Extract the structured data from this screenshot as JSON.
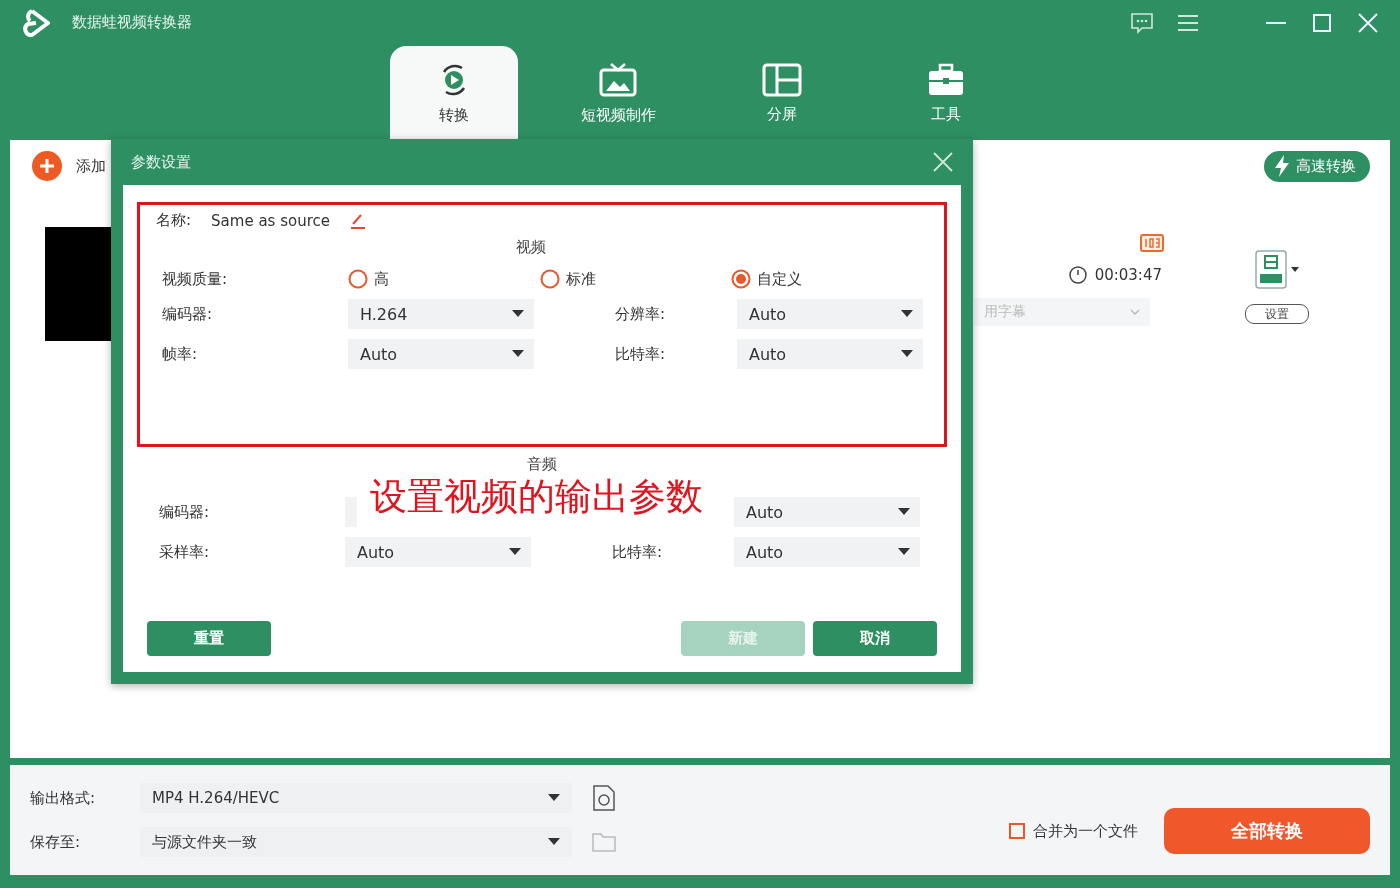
{
  "app": {
    "title": "数据蛙视频转换器"
  },
  "tabs": [
    {
      "kind": "convert",
      "label": "转换",
      "selected": true
    },
    {
      "kind": "short",
      "label": "短视频制作",
      "selected": false
    },
    {
      "kind": "split",
      "label": "分屏",
      "selected": false
    },
    {
      "kind": "tools",
      "label": "工具",
      "selected": false
    }
  ],
  "toolbar": {
    "add_label": "添加",
    "speed_button": "高速转换"
  },
  "file_item": {
    "duration": "00:03:47",
    "subtitle": "用字幕",
    "settings_button": "设置"
  },
  "dialog": {
    "title": "参数设置",
    "name_label": "名称:",
    "name_value": "Same as source",
    "video_heading": "视频",
    "quality_label": "视频质量:",
    "quality_options": [
      {
        "label": "高",
        "selected": false
      },
      {
        "label": "标准",
        "selected": false
      },
      {
        "label": "自定义",
        "selected": true
      }
    ],
    "video_rows": [
      {
        "left": {
          "label": "编码器:",
          "value": "H.264"
        },
        "right": {
          "label": "分辨率:",
          "value": "Auto"
        }
      },
      {
        "left": {
          "label": "帧率:",
          "value": "Auto"
        },
        "right": {
          "label": "比特率:",
          "value": "Auto"
        }
      }
    ],
    "audio_heading": "音频",
    "audio_rows": [
      {
        "left": {
          "label": "编码器:"
        },
        "right": {
          "value": "Auto"
        }
      },
      {
        "left": {
          "label": "采样率:",
          "value": "Auto"
        },
        "right": {
          "label": "比特率:",
          "value": "Auto"
        }
      }
    ],
    "buttons": [
      {
        "label": "重置",
        "disabled": false
      },
      {
        "label": "新建",
        "disabled": true
      },
      {
        "label": "取消",
        "disabled": false
      }
    ]
  },
  "annotation": {
    "text": "设置视频的输出参数"
  },
  "bottom": {
    "format_label": "输出格式:",
    "format_value": "MP4 H.264/HEVC",
    "save_label": "保存至:",
    "save_value": "与源文件夹一致",
    "merge": {
      "label": "合并为一个文件",
      "checked": false
    },
    "convert_button": "全部转换"
  }
}
